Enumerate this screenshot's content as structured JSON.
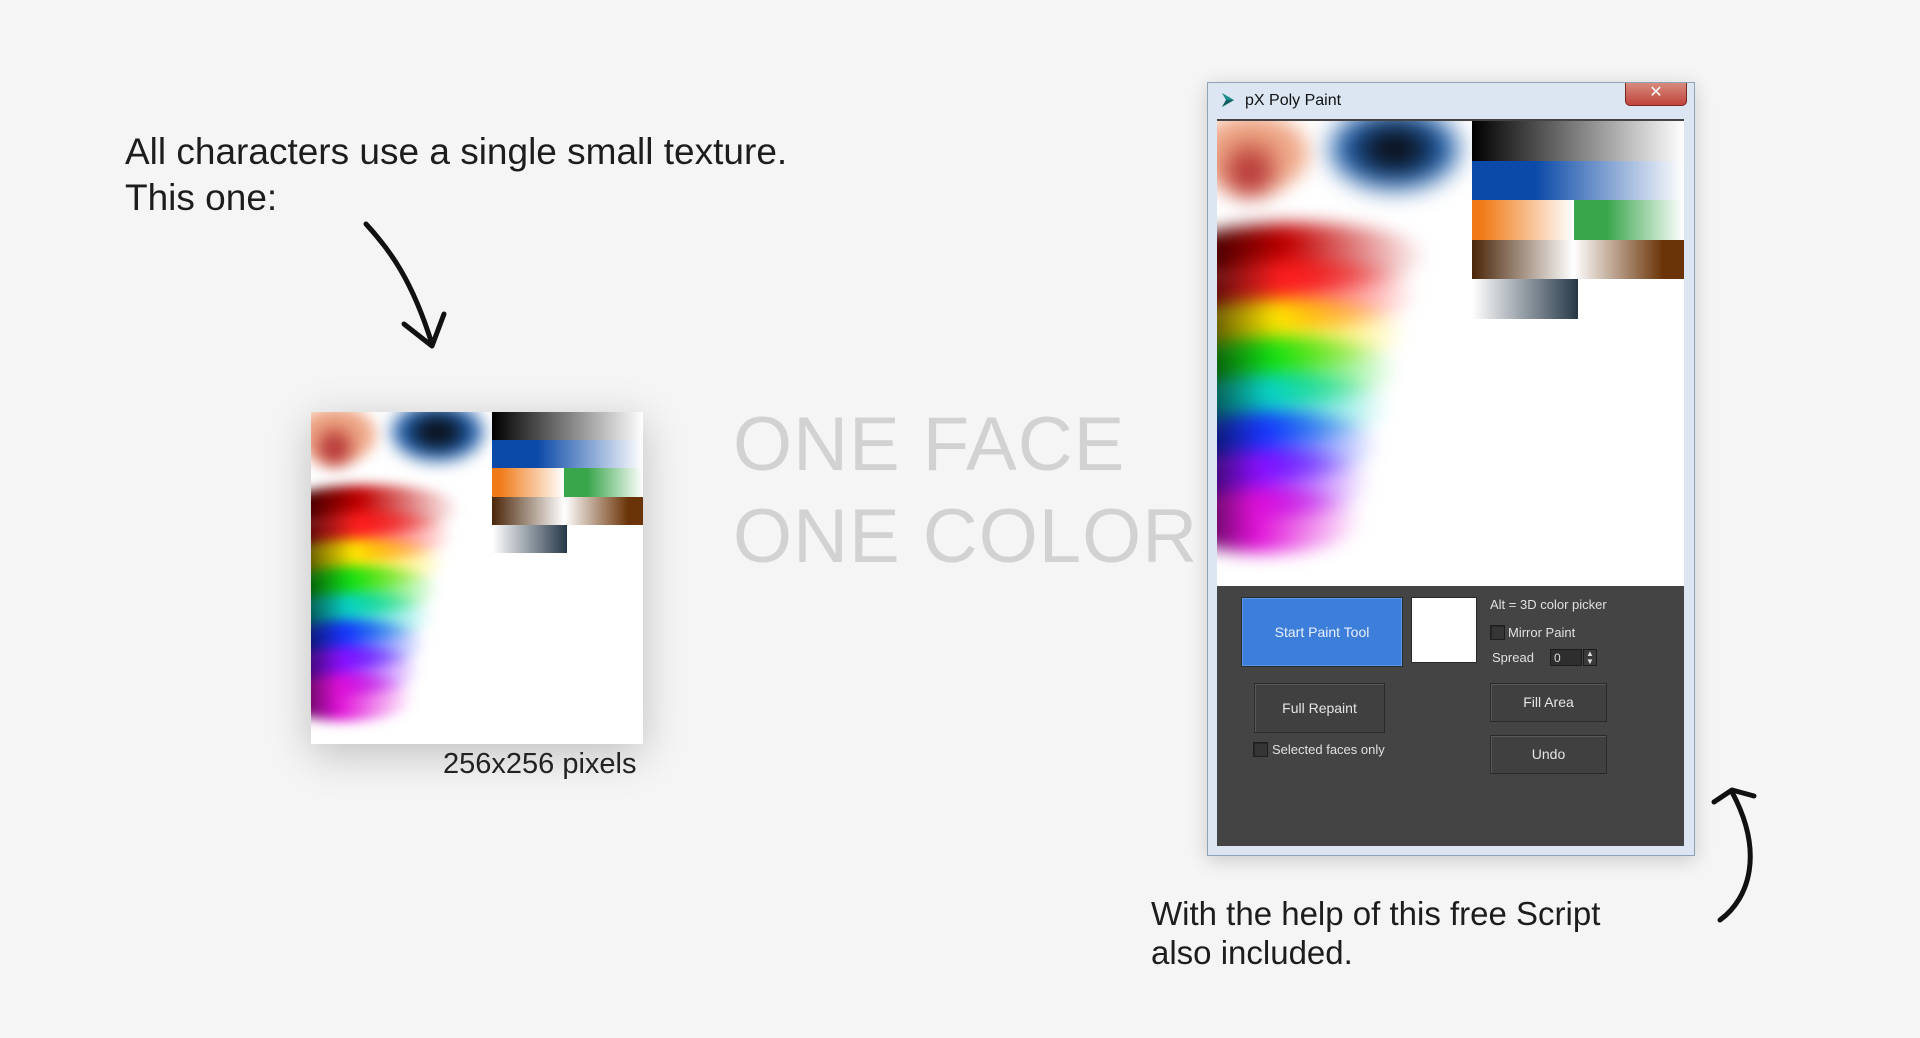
{
  "captions": {
    "intro_line1": "All characters use a single small texture.",
    "intro_line2": "This one:",
    "size_label": "256x256 pixels",
    "headline_line1": "ONE FACE",
    "headline_line2": "ONE COLOR",
    "outro_line1": "With the help of this free Script",
    "outro_line2": "also included."
  },
  "window": {
    "title": "pX Poly Paint",
    "close_glyph": "✕",
    "start_button": "Start Paint Tool",
    "color_swatch": "#ffffff",
    "alt_hint": "Alt = 3D color picker",
    "mirror_label": "Mirror Paint",
    "mirror_checked": false,
    "spread_label": "Spread",
    "spread_value": "0",
    "full_repaint_button": "Full Repaint",
    "fill_area_button": "Fill Area",
    "undo_button": "Undo",
    "selected_faces_label": "Selected faces only",
    "selected_faces_checked": false
  },
  "icons": {
    "title_icon": "3ds-max-logo-icon",
    "arrow_down": "hand-drawn-arrow-down-icon",
    "arrow_up": "hand-drawn-arrow-up-icon",
    "spinner": "up-down-spinner-icon"
  },
  "colors": {
    "background": "#f5f5f5",
    "headline": "#d2d2d2",
    "start_button": "#3d7edb",
    "panel": "#444444"
  },
  "texture_palette": [
    {
      "name": "grayscale",
      "colors": [
        "#000000",
        "#ffffff"
      ]
    },
    {
      "name": "blue",
      "colors": [
        "#0b4aa8",
        "#ffffff"
      ]
    },
    {
      "name": "orange",
      "colors": [
        "#f07a17",
        "#ffffff"
      ]
    },
    {
      "name": "green",
      "colors": [
        "#3aa64c",
        "#ffffff"
      ]
    },
    {
      "name": "brown-skin",
      "colors": [
        "#4a2508",
        "#ffffff",
        "#6b3408"
      ]
    },
    {
      "name": "slate",
      "colors": [
        "#ffffff",
        "#263848"
      ]
    },
    {
      "name": "spectrum",
      "colors": [
        "#c20000",
        "#ff2020",
        "#ffe600",
        "#13e013",
        "#0ad3c7",
        "#1a35ff",
        "#8a10ff",
        "#e010d8"
      ]
    }
  ]
}
